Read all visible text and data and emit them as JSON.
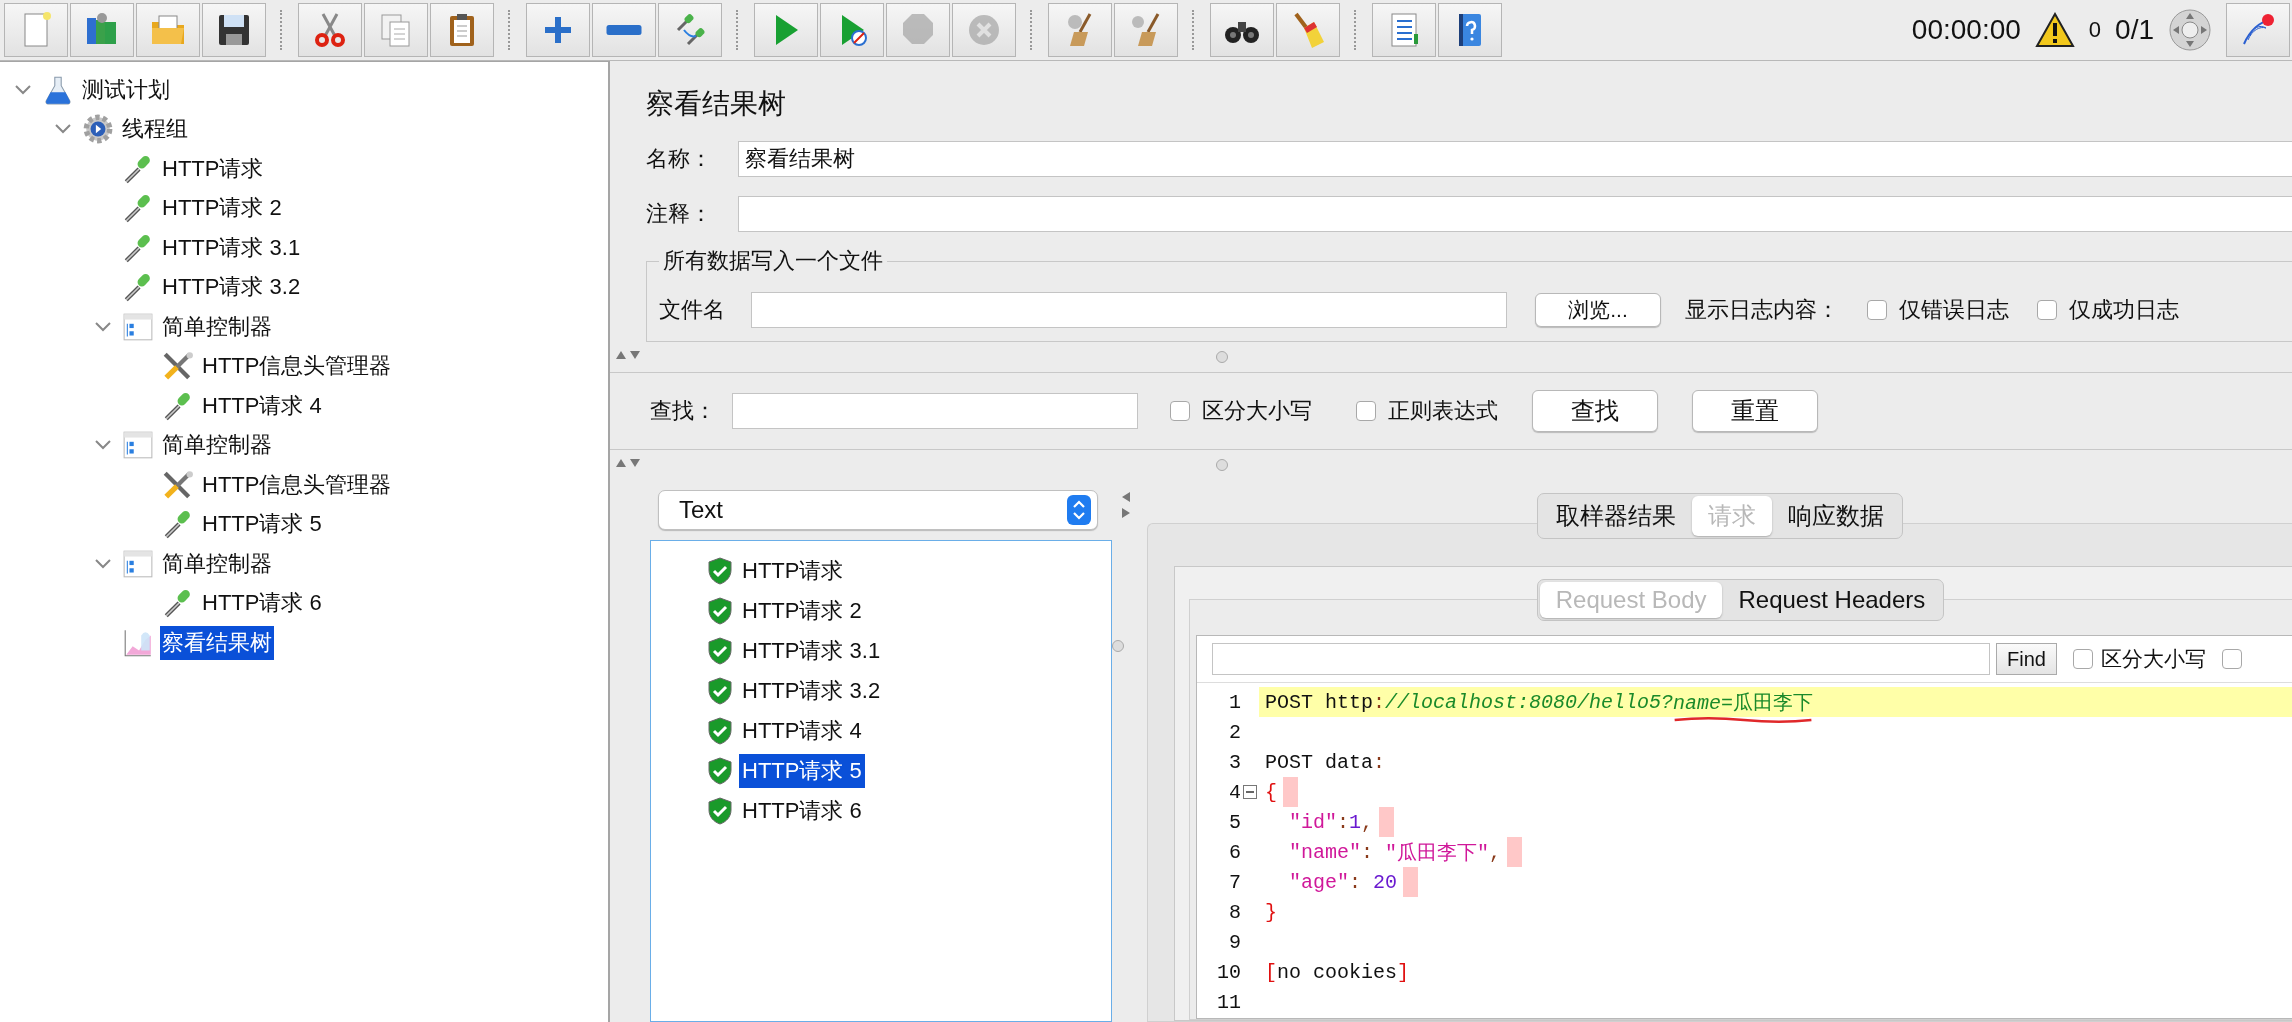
{
  "toolbar": {
    "groups": [
      [
        {
          "disabled": false
        },
        {
          "disabled": false
        },
        {
          "disabled": false
        },
        {
          "disabled": false
        }
      ],
      [
        {
          "disabled": false
        },
        {
          "disabled": false
        },
        {
          "disabled": false
        }
      ],
      [
        {
          "disabled": false
        },
        {
          "disabled": false
        },
        {
          "disabled": false
        }
      ],
      [
        {
          "disabled": false
        },
        {
          "disabled": false
        },
        {
          "disabled": true
        },
        {
          "disabled": true
        }
      ],
      [
        {
          "disabled": false
        },
        {
          "disabled": false
        }
      ],
      [
        {
          "disabled": false
        },
        {
          "disabled": false
        }
      ],
      [
        {
          "disabled": false
        },
        {
          "disabled": false
        }
      ]
    ],
    "timer": "00:00:00",
    "warning_count": "0",
    "threads": "0/1"
  },
  "tree": [
    {
      "kind": "plan",
      "label": "测试计划",
      "expanded": true,
      "selected": false,
      "children": [
        {
          "kind": "thread-group",
          "label": "线程组",
          "expanded": true,
          "selected": false,
          "children": [
            {
              "kind": "sampler",
              "label": "HTTP请求",
              "selected": false
            },
            {
              "kind": "sampler",
              "label": "HTTP请求 2",
              "selected": false
            },
            {
              "kind": "sampler",
              "label": "HTTP请求 3.1",
              "selected": false
            },
            {
              "kind": "sampler",
              "label": "HTTP请求 3.2",
              "selected": false
            },
            {
              "kind": "controller",
              "label": "简单控制器",
              "expanded": true,
              "selected": false,
              "children": [
                {
                  "kind": "config",
                  "label": "HTTP信息头管理器",
                  "selected": false
                },
                {
                  "kind": "sampler",
                  "label": "HTTP请求 4",
                  "selected": false
                }
              ]
            },
            {
              "kind": "controller",
              "label": "简单控制器",
              "expanded": true,
              "selected": false,
              "children": [
                {
                  "kind": "config",
                  "label": "HTTP信息头管理器",
                  "selected": false
                },
                {
                  "kind": "sampler",
                  "label": "HTTP请求 5",
                  "selected": false
                }
              ]
            },
            {
              "kind": "controller",
              "label": "简单控制器",
              "expanded": true,
              "selected": false,
              "children": [
                {
                  "kind": "sampler",
                  "label": "HTTP请求 6",
                  "selected": false
                }
              ]
            },
            {
              "kind": "listener",
              "label": "察看结果树",
              "selected": true
            }
          ]
        }
      ]
    }
  ],
  "title": "察看结果树",
  "name_field": {
    "label": "名称：",
    "value": "察看结果树"
  },
  "comment_field": {
    "label": "注释："
  },
  "file_group": {
    "title": "所有数据写入一个文件",
    "filename_label": "文件名",
    "browse_button": "浏览...",
    "log_label": "显示日志内容：",
    "checkboxes": [
      {
        "label": "仅错误日志",
        "checked": false
      },
      {
        "label": "仅成功日志",
        "checked": false
      }
    ]
  },
  "search": {
    "label": "查找：",
    "checkboxes": [
      {
        "label": "区分大小写",
        "checked": false
      },
      {
        "label": "正则表达式",
        "checked": false
      }
    ],
    "buttons": [
      "查找",
      "重置"
    ]
  },
  "results": {
    "renderer": "Text",
    "items": [
      {
        "label": "HTTP请求",
        "selected": false
      },
      {
        "label": "HTTP请求 2",
        "selected": false
      },
      {
        "label": "HTTP请求 3.1",
        "selected": false
      },
      {
        "label": "HTTP请求 3.2",
        "selected": false
      },
      {
        "label": "HTTP请求 4",
        "selected": false
      },
      {
        "label": "HTTP请求 5",
        "selected": true
      },
      {
        "label": "HTTP请求 6",
        "selected": false
      }
    ],
    "tabs": [
      {
        "label": "取样器结果",
        "selected": false
      },
      {
        "label": "请求",
        "selected": true
      },
      {
        "label": "响应数据",
        "selected": false
      }
    ],
    "subtabs": [
      {
        "label": "Request Body",
        "selected": true
      },
      {
        "label": "Request Headers",
        "selected": false
      }
    ],
    "find_button": "Find",
    "find_checkboxes": [
      {
        "label": "区分大小写",
        "checked": false
      },
      {
        "checked": false
      }
    ],
    "lines": [
      {
        "number": "1",
        "current": true,
        "fold": false,
        "trailing": false,
        "segments": [
          {
            "kind": "plain",
            "text": "POST http"
          },
          {
            "kind": "punct",
            "text": ":"
          },
          {
            "kind": "url",
            "text": "//localhost:8080/hello5?"
          },
          {
            "kind": "url",
            "text": "name",
            "underlined": true
          },
          {
            "kind": "value",
            "text": "=瓜田李下",
            "underlined": true
          }
        ]
      },
      {
        "number": "2",
        "current": false,
        "fold": false,
        "trailing": false
      },
      {
        "number": "3",
        "current": false,
        "fold": false,
        "trailing": false,
        "segments": [
          {
            "kind": "plain",
            "text": "POST data"
          },
          {
            "kind": "punct",
            "text": ":"
          }
        ]
      },
      {
        "number": "4",
        "current": false,
        "fold": true,
        "trailing": true,
        "segments": [
          {
            "kind": "brace",
            "text": "{"
          }
        ]
      },
      {
        "number": "5",
        "current": false,
        "fold": false,
        "trailing": true,
        "segments": [
          {
            "kind": "key",
            "text": "  \"id\""
          },
          {
            "kind": "punct",
            "text": ":"
          },
          {
            "kind": "number",
            "text": "1"
          },
          {
            "kind": "punct",
            "text": ","
          }
        ]
      },
      {
        "number": "6",
        "current": false,
        "fold": false,
        "trailing": true,
        "segments": [
          {
            "kind": "key",
            "text": "  \"name\""
          },
          {
            "kind": "punct",
            "text": ": "
          },
          {
            "kind": "key",
            "text": "\"瓜田李下\""
          },
          {
            "kind": "punct",
            "text": ","
          }
        ]
      },
      {
        "number": "7",
        "current": false,
        "fold": false,
        "trailing": true,
        "segments": [
          {
            "kind": "key",
            "text": "  \"age\""
          },
          {
            "kind": "punct",
            "text": ": "
          },
          {
            "kind": "number",
            "text": "20"
          }
        ]
      },
      {
        "number": "8",
        "current": false,
        "fold": false,
        "trailing": false,
        "segments": [
          {
            "kind": "brace",
            "text": "}"
          }
        ]
      },
      {
        "number": "9",
        "current": false,
        "fold": false,
        "trailing": false
      },
      {
        "number": "10",
        "current": false,
        "fold": false,
        "trailing": false,
        "segments": [
          {
            "kind": "brace",
            "text": "["
          },
          {
            "kind": "plain",
            "text": "no cookies"
          },
          {
            "kind": "brace",
            "text": "]"
          }
        ]
      },
      {
        "number": "11",
        "current": false,
        "fold": false,
        "trailing": false
      }
    ]
  }
}
